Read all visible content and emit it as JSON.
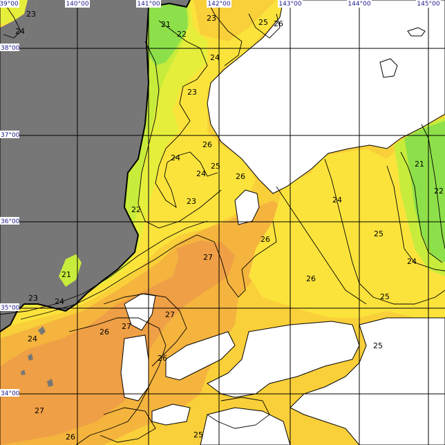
{
  "map": {
    "land_color": "#777777",
    "no_data_color": "#ffffff",
    "colors": {
      "t21": "#8ee04a",
      "t22": "#c8ec3c",
      "t23": "#e6ee3c",
      "t24": "#fbe33c",
      "t25": "#f9cf3a",
      "t26": "#f4b43e",
      "t27": "#ef9f45"
    }
  },
  "longitude_labels": [
    "39°00",
    "140°00",
    "141°00",
    "142°00",
    "143°00",
    "144°00",
    "145°00"
  ],
  "latitude_labels": [
    "38°00",
    "37°00",
    "36°00",
    "35°00",
    "34°00"
  ],
  "sst_labels": [
    "23",
    "24",
    "21",
    "22",
    "23",
    "25",
    "26",
    "24",
    "23",
    "24",
    "26",
    "24",
    "25",
    "26",
    "21",
    "22",
    "22",
    "24",
    "23",
    "26",
    "24",
    "25",
    "27",
    "26",
    "25",
    "24",
    "21",
    "23",
    "24",
    "27",
    "27",
    "26",
    "25",
    "26",
    "25",
    "27",
    "26",
    "25"
  ]
}
